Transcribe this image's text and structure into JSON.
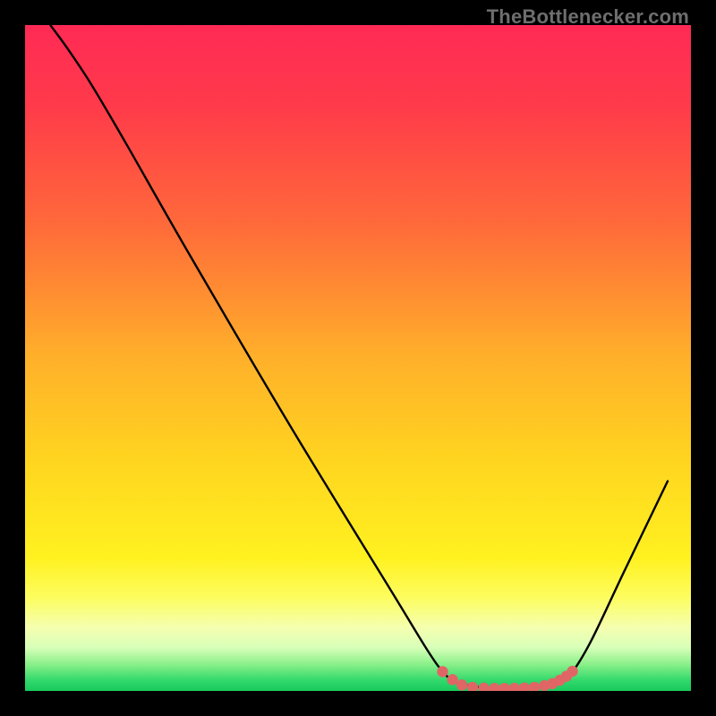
{
  "watermark": "TheBottlenecker.com",
  "chart_data": {
    "type": "line",
    "title": "",
    "xlabel": "",
    "ylabel": "",
    "xlim": [
      0,
      100
    ],
    "ylim": [
      0,
      100
    ],
    "gradient_stops": [
      {
        "offset": 0.0,
        "color": "#ff2a55"
      },
      {
        "offset": 0.12,
        "color": "#ff3a4a"
      },
      {
        "offset": 0.3,
        "color": "#ff6a3a"
      },
      {
        "offset": 0.5,
        "color": "#ffb02a"
      },
      {
        "offset": 0.66,
        "color": "#ffd61f"
      },
      {
        "offset": 0.8,
        "color": "#fff120"
      },
      {
        "offset": 0.86,
        "color": "#fdfd60"
      },
      {
        "offset": 0.905,
        "color": "#f5ffb0"
      },
      {
        "offset": 0.935,
        "color": "#d8ffb8"
      },
      {
        "offset": 0.96,
        "color": "#8af089"
      },
      {
        "offset": 0.985,
        "color": "#2fd86a"
      },
      {
        "offset": 1.0,
        "color": "#19c95c"
      }
    ],
    "series": [
      {
        "name": "curve",
        "points": [
          {
            "x": 3.8,
            "y": 100.0
          },
          {
            "x": 6.5,
            "y": 96.3
          },
          {
            "x": 10.0,
            "y": 91.0
          },
          {
            "x": 15.0,
            "y": 82.5
          },
          {
            "x": 25.0,
            "y": 65.0
          },
          {
            "x": 40.0,
            "y": 39.5
          },
          {
            "x": 55.0,
            "y": 15.0
          },
          {
            "x": 60.5,
            "y": 6.0
          },
          {
            "x": 63.0,
            "y": 2.6
          },
          {
            "x": 65.0,
            "y": 1.2
          },
          {
            "x": 70.0,
            "y": 0.4
          },
          {
            "x": 76.0,
            "y": 0.4
          },
          {
            "x": 80.0,
            "y": 1.2
          },
          {
            "x": 82.0,
            "y": 2.6
          },
          {
            "x": 85.0,
            "y": 7.5
          },
          {
            "x": 90.0,
            "y": 18.0
          },
          {
            "x": 96.5,
            "y": 31.5
          }
        ]
      },
      {
        "name": "flat-markers",
        "type": "scatter",
        "points": [
          {
            "x": 62.7,
            "y": 2.9
          },
          {
            "x": 64.2,
            "y": 1.7
          },
          {
            "x": 65.6,
            "y": 0.9
          },
          {
            "x": 67.2,
            "y": 0.55
          },
          {
            "x": 68.9,
            "y": 0.42
          },
          {
            "x": 70.5,
            "y": 0.38
          },
          {
            "x": 72.0,
            "y": 0.38
          },
          {
            "x": 73.5,
            "y": 0.4
          },
          {
            "x": 75.0,
            "y": 0.45
          },
          {
            "x": 76.5,
            "y": 0.55
          },
          {
            "x": 78.0,
            "y": 0.8
          },
          {
            "x": 79.2,
            "y": 1.1
          },
          {
            "x": 80.3,
            "y": 1.6
          },
          {
            "x": 81.3,
            "y": 2.2
          },
          {
            "x": 82.2,
            "y": 2.95
          }
        ]
      }
    ]
  }
}
